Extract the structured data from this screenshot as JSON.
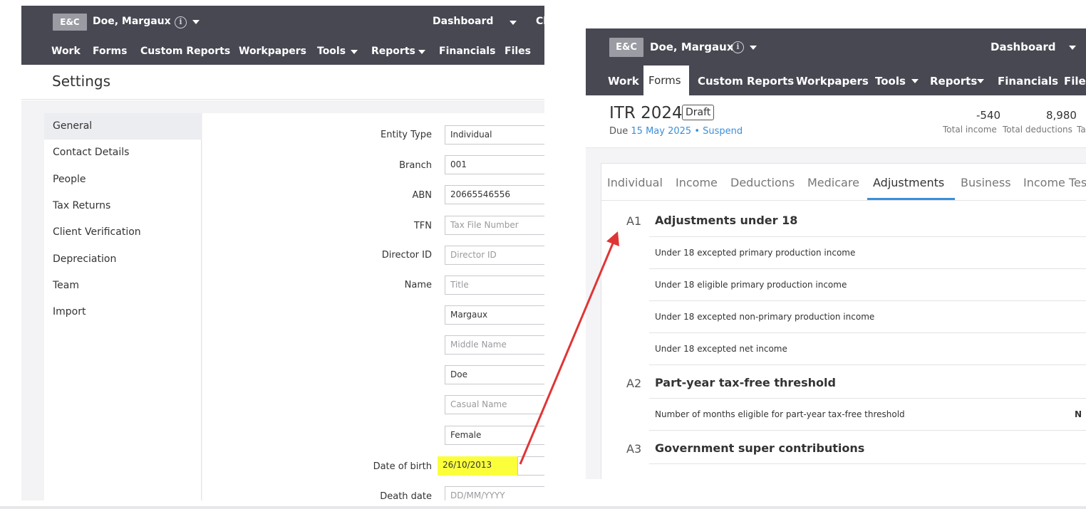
{
  "left": {
    "org_badge": "E&C",
    "user_name": "Doe, Margaux",
    "info_icon": "i",
    "dashboard": "Dashboard",
    "cut_link": "Cl",
    "nav": [
      "Work",
      "Forms",
      "Custom Reports",
      "Workpapers",
      "Tools",
      "Reports",
      "Financials",
      "Files"
    ],
    "page_title": "Settings",
    "menu": [
      "General",
      "Contact Details",
      "People",
      "Tax Returns",
      "Client Verification",
      "Depreciation",
      "Team",
      "Import"
    ],
    "form": {
      "entity_type_label": "Entity Type",
      "entity_type_value": "Individual",
      "branch_label": "Branch",
      "branch_value": "001",
      "abn_label": "ABN",
      "abn_value": "20665546556",
      "tfn_label": "TFN",
      "tfn_placeholder": "Tax File Number",
      "director_label": "Director ID",
      "director_placeholder": "Director ID",
      "name_label": "Name",
      "title_placeholder": "Title",
      "first_name": "Margaux",
      "middle_placeholder": "Middle Name",
      "last_name": "Doe",
      "casual_placeholder": "Casual Name",
      "gender": "Female",
      "dob_label": "Date of birth",
      "dob_value": "26/10/2013",
      "death_label": "Death date",
      "death_placeholder": "DD/MM/YYYY"
    }
  },
  "right": {
    "org_badge": "E&C",
    "user_name": "Doe, Margaux",
    "info_icon": "i",
    "dashboard": "Dashboard",
    "nav": [
      "Work",
      "Forms",
      "Custom Reports",
      "Workpapers",
      "Tools",
      "Reports",
      "Financials",
      "Files"
    ],
    "form_title": "ITR 2024",
    "status_badge": "Draft",
    "due_prefix": "Due",
    "due_date": "15 May 2025",
    "due_sep": "•",
    "suspend": "Suspend",
    "stats": [
      {
        "value": "-540",
        "label": "Total income"
      },
      {
        "value": "8,980",
        "label": "Total deductions"
      }
    ],
    "stat_cut_label": "Ta",
    "tabs": [
      "Individual",
      "Income",
      "Deductions",
      "Medicare",
      "Adjustments",
      "Business",
      "Income Tes"
    ],
    "sections": [
      {
        "num": "A1",
        "title": "Adjustments under 18",
        "rows": [
          "Under 18 excepted primary production income",
          "Under 18 eligible primary production income",
          "Under 18 excepted non-primary production income",
          "Under 18 excepted net income"
        ]
      },
      {
        "num": "A2",
        "title": "Part-year tax-free threshold",
        "rows": [
          "Number of months eligible for part-year tax-free threshold"
        ],
        "row_value": "N"
      },
      {
        "num": "A3",
        "title": "Government super contributions",
        "rows": []
      }
    ]
  },
  "colors": {
    "topbar": "#474852",
    "accent": "#3a8fd8",
    "highlight": "#fbff3b",
    "arrow": "#e03535"
  }
}
